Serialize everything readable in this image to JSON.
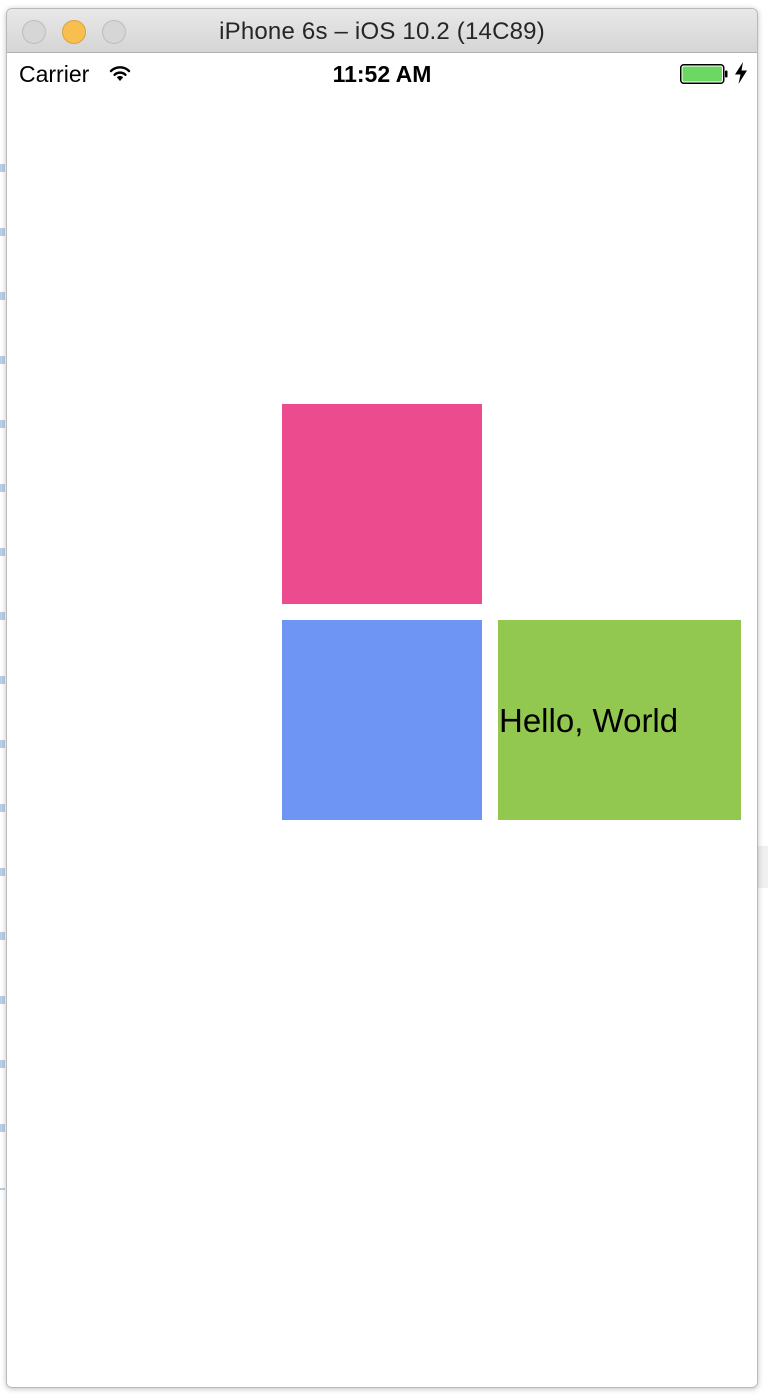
{
  "window": {
    "title": "iPhone 6s – iOS 10.2 (14C89)"
  },
  "status_bar": {
    "carrier": "Carrier",
    "time": "11:52 AM",
    "wifi_icon": "wifi-icon",
    "battery_icon": "battery-icon",
    "charging_icon": "charging-bolt-icon",
    "battery_level": 1.0
  },
  "content": {
    "boxes": [
      {
        "name": "pink-box",
        "color": "#ec4b8d"
      },
      {
        "name": "blue-box",
        "color": "#6e95f4"
      },
      {
        "name": "green-box",
        "color": "#93c850"
      }
    ],
    "hello_label": "Hello, World"
  },
  "colors": {
    "battery_fill": "#6cd863",
    "traffic_minimize": "#f6bf4f"
  }
}
